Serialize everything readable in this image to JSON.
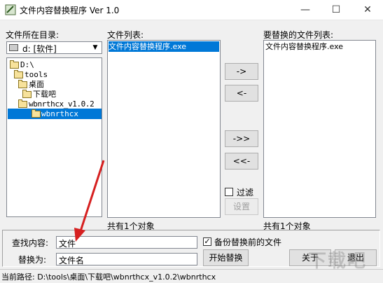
{
  "window": {
    "title": "文件内容替换程序 Ver 1.0",
    "minimize": "—",
    "maximize": "☐",
    "close": "✕"
  },
  "left": {
    "dir_label": "文件所在目录:",
    "drive_value": "d: [软件]",
    "tree": [
      "D:\\",
      "tools",
      "桌面",
      "下载吧",
      "wbnrthcx_v1.0.2",
      "wbnrthcx"
    ],
    "selected_index": 5
  },
  "middle": {
    "list_label": "文件列表:",
    "items": [
      "文件内容替换程序.exe"
    ],
    "count": "共有1个对象"
  },
  "right": {
    "list_label": "要替换的文件列表:",
    "items": [
      "文件内容替换程序.exe"
    ],
    "count": "共有1个对象"
  },
  "buttons": {
    "add": "->",
    "remove": "<-",
    "add_all": "->>",
    "remove_all": "<<-",
    "filter_label": "过滤",
    "settings": "设置",
    "start": "开始替换",
    "about": "关于",
    "exit": "退出"
  },
  "search": {
    "find_label": "查找内容:",
    "find_value": "文件",
    "replace_label": "替换为:",
    "replace_value": "文件名",
    "backup_label": "备份替换前的文件",
    "backup_checked": true
  },
  "status": {
    "path_text": "当前路径: D:\\tools\\桌面\\下载吧\\wbnrthcx_v1.0.2\\wbnrthcx"
  },
  "watermark": "下载吧"
}
